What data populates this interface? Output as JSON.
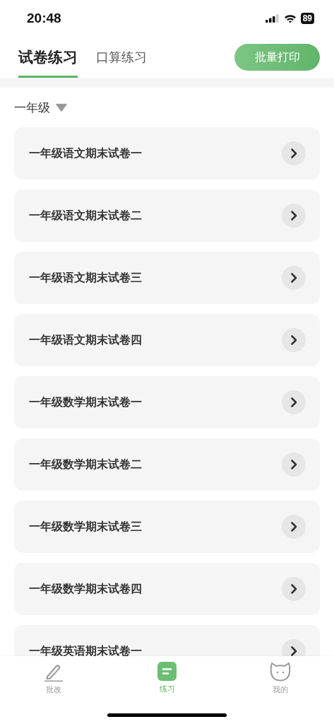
{
  "status_bar": {
    "time": "20:48",
    "battery": "89"
  },
  "tabs": [
    {
      "label": "试卷练习",
      "selected": true
    },
    {
      "label": "口算练习",
      "selected": false
    }
  ],
  "print_button": "批量打印",
  "grade_filter": {
    "label": "一年级",
    "expanded": false
  },
  "papers": [
    "一年级语文期末试卷一",
    "一年级语文期末试卷二",
    "一年级语文期末试卷三",
    "一年级语文期末试卷四",
    "一年级数学期末试卷一",
    "一年级数学期末试卷二",
    "一年级数学期末试卷三",
    "一年级数学期末试卷四",
    "一年级英语期末试卷一"
  ],
  "bottom_nav": [
    {
      "kind": "pen",
      "label": "批改",
      "selected": false
    },
    {
      "kind": "practice",
      "label": "练习",
      "selected": true
    },
    {
      "kind": "cat",
      "label": "我的",
      "selected": false
    }
  ]
}
